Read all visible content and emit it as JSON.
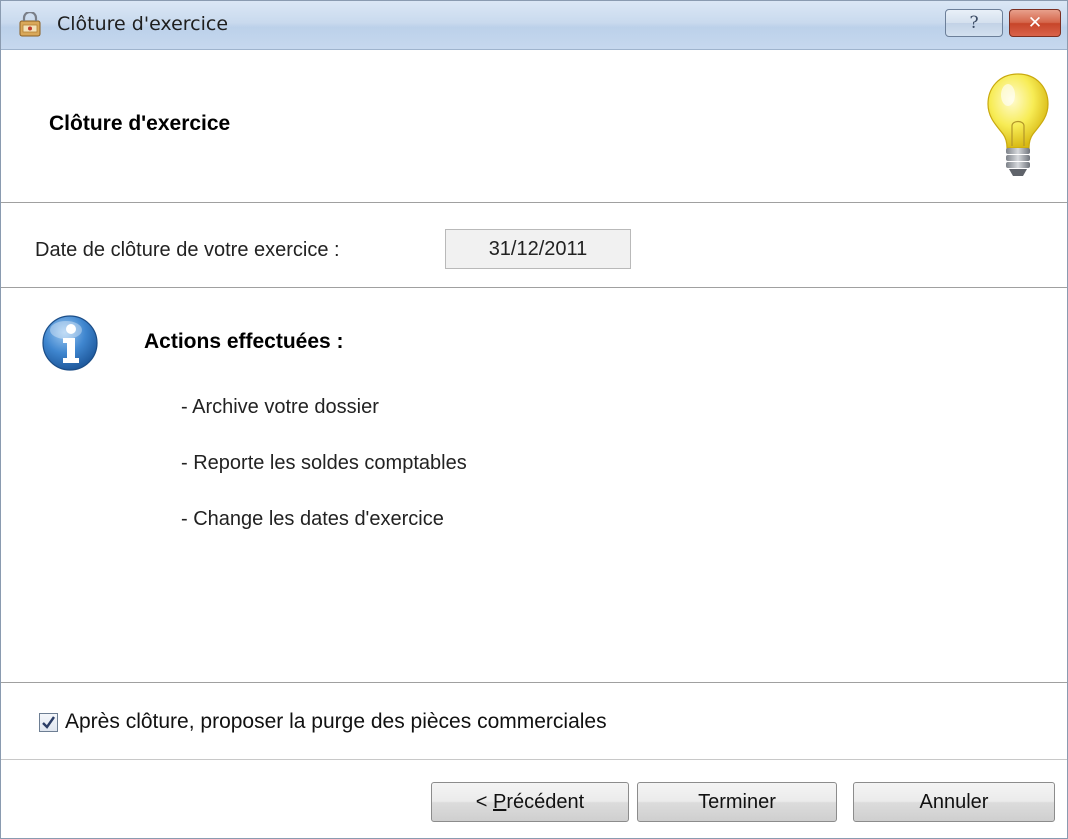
{
  "window": {
    "title": "Clôture d'exercice",
    "help_glyph": "?",
    "close_glyph": "✕"
  },
  "header": {
    "title": "Clôture d'exercice"
  },
  "date": {
    "label": "Date de clôture de votre exercice :",
    "value": "31/12/2011"
  },
  "info": {
    "title": "Actions effectuées :",
    "actions": [
      "- Archive votre dossier",
      "- Reporte les soldes comptables",
      "- Change les dates d'exercice"
    ]
  },
  "options": {
    "purge_label": "Après clôture, proposer la purge des pièces commerciales",
    "purge_checked": true
  },
  "buttons": {
    "previous_prefix": "< ",
    "previous_mnemonic": "P",
    "previous_rest": "récédent",
    "finish": "Terminer",
    "cancel": "Annuler"
  },
  "icons": {
    "title": "accounting-lock-icon",
    "header": "lightbulb-icon",
    "info": "info-icon"
  },
  "colors": {
    "titlebar": "#c9daee",
    "close": "#c7452a",
    "info_blue": "#2f6fb6",
    "bulb_yellow": "#f6e94a"
  }
}
